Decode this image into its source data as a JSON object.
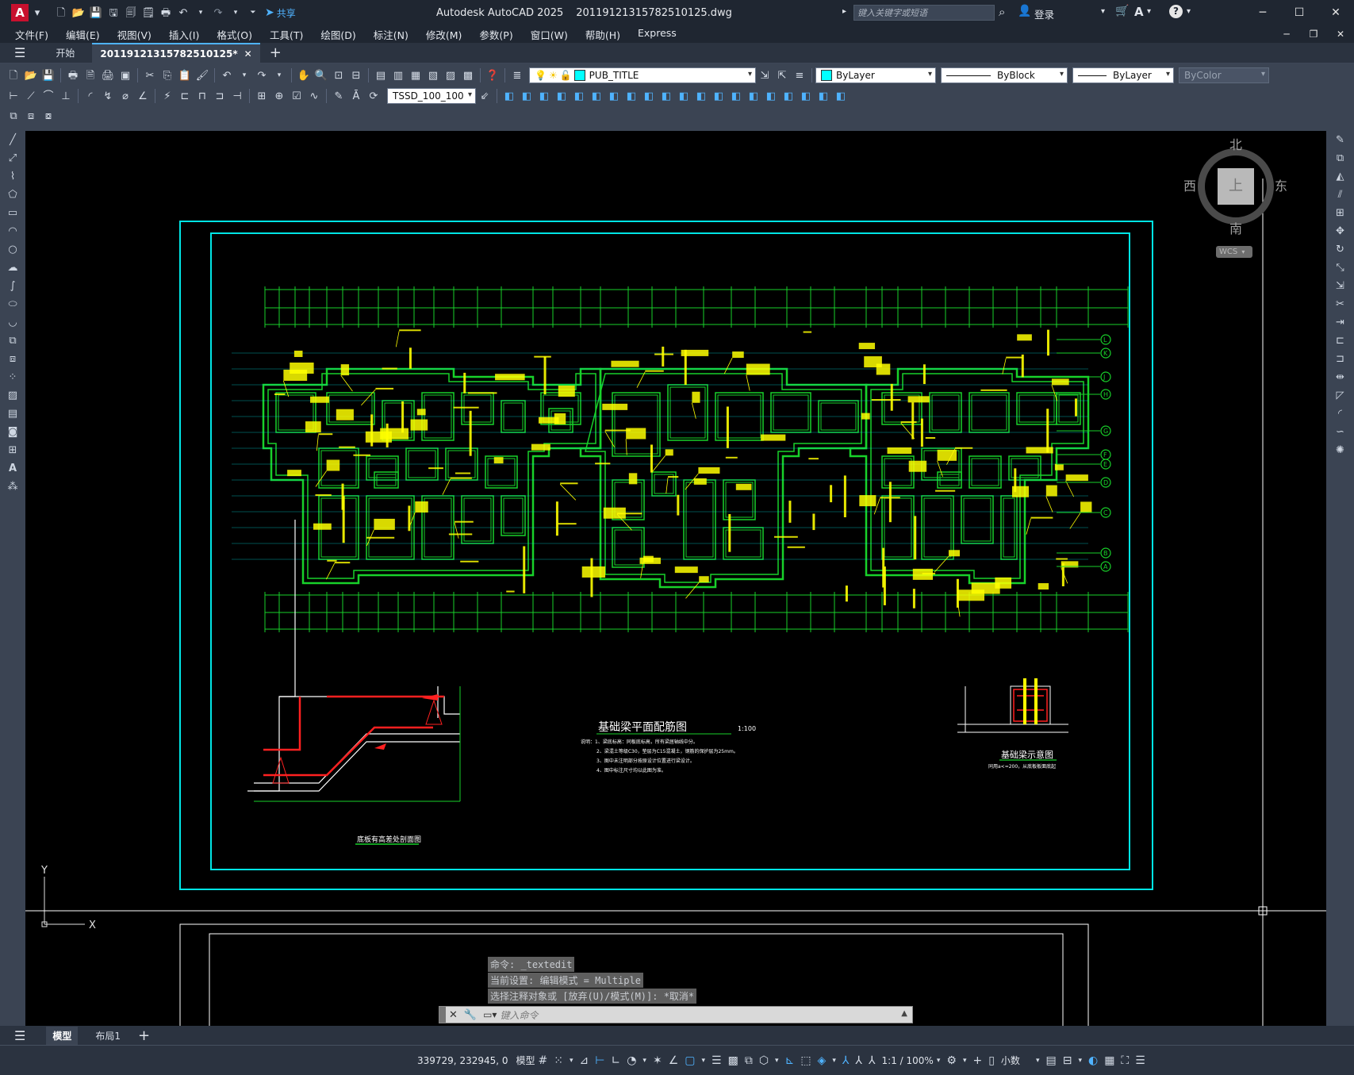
{
  "titlebar": {
    "app_title": "Autodesk AutoCAD 2025",
    "file_name": "20119121315782510125.dwg",
    "share_label": "共享",
    "search_placeholder": "键入关键字或短语",
    "login_label": "登录"
  },
  "menubar": {
    "items": [
      "文件(F)",
      "编辑(E)",
      "视图(V)",
      "插入(I)",
      "格式(O)",
      "工具(T)",
      "绘图(D)",
      "标注(N)",
      "修改(M)",
      "参数(P)",
      "窗口(W)",
      "帮助(H)",
      "Express"
    ]
  },
  "doc_tabs": {
    "home": "开始",
    "active": "20119121315782510125*"
  },
  "properties": {
    "layer": "PUB_TITLE",
    "color": "ByLayer",
    "linetype": "ByBlock",
    "lineweight": "ByLayer",
    "plotstyle": "ByColor",
    "dimstyle": "TSSD_100_100"
  },
  "viewcube": {
    "north": "北",
    "south": "南",
    "east": "东",
    "west": "西",
    "face": "上",
    "wcs": "WCS"
  },
  "drawing": {
    "plan_title": "基础梁平面配筋图",
    "plan_scale": "1:100",
    "notes": [
      "说明：1、梁底标高：同板底标高，所有梁居轴线中分。",
      "2、梁混土等级C30，垫层为C15混凝土，钢筋的保护层为25mm。",
      "3、图中未注明部分按原设计位置进行梁设计。",
      "4、图中标注尺寸均以此图为准。"
    ],
    "section_title": "底板有高差处剖面图",
    "detail_title": "基础梁示意图",
    "detail_note": "同用a<=200，从底板板面底起",
    "axis_right": [
      "L",
      "K",
      "J",
      "H",
      "G",
      "F",
      "E",
      "D",
      "C",
      "B",
      "A"
    ]
  },
  "command": {
    "lines": [
      "命令: _textedit",
      "当前设置: 编辑模式 = Multiple",
      "选择注释对象或 [放弃(U)/模式(M)]: *取消*"
    ],
    "input_placeholder": "键入命令"
  },
  "layout_tabs": [
    "模型",
    "布局1"
  ],
  "statusbar": {
    "coords": "339729, 232945, 0",
    "model_label": "模型",
    "scale": "1:1 / 100%",
    "units": "小数"
  },
  "colors": {
    "frame": "#00e5e5",
    "wall": "#18d12a",
    "text": "#ffff00",
    "background": "#000000",
    "chrome": "#3b4453"
  }
}
